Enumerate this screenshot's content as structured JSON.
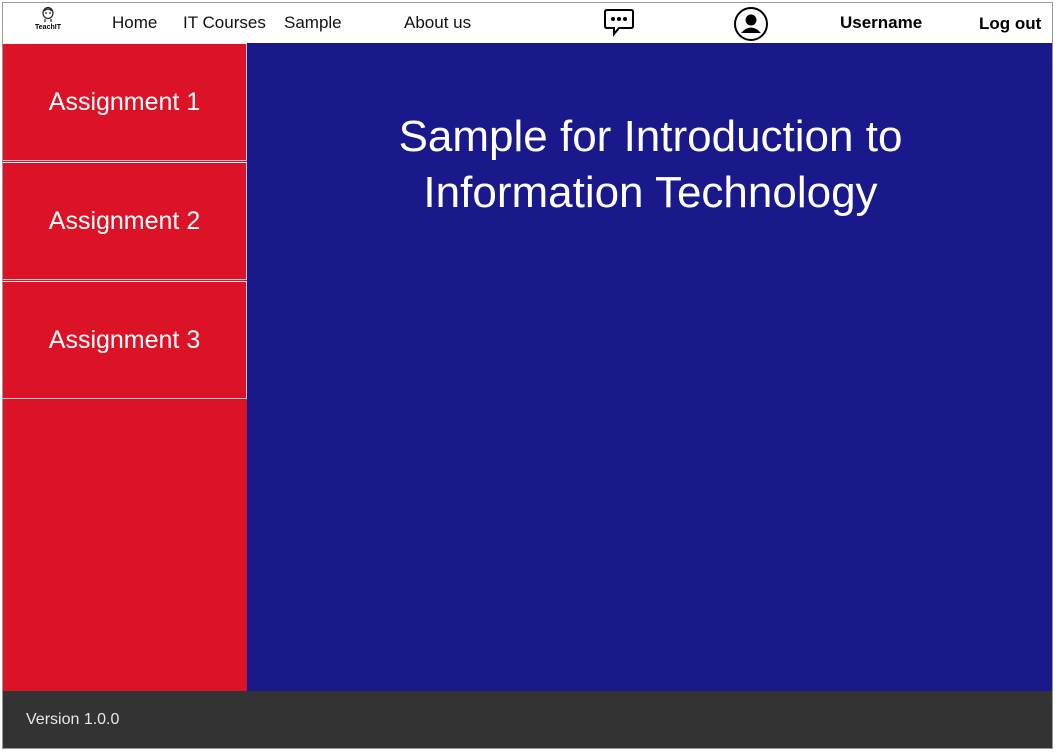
{
  "header": {
    "logo_text": "TeachIT",
    "nav": [
      "Home",
      "IT Courses",
      "Sample",
      "About us"
    ],
    "chat_icon": "chat-bubble-icon",
    "user_icon": "user-avatar-icon",
    "username": "Username",
    "logout": "Log out"
  },
  "sidebar": {
    "items": [
      {
        "label": "Assignment 1"
      },
      {
        "label": "Assignment 2"
      },
      {
        "label": "Assignment 3"
      }
    ]
  },
  "main": {
    "title": "Sample for Introduction to Information Technology"
  },
  "footer": {
    "version": "Version 1.0.0"
  },
  "colors": {
    "sidebar": "#dc1226",
    "main": "#1a198c",
    "footer": "#333333"
  }
}
